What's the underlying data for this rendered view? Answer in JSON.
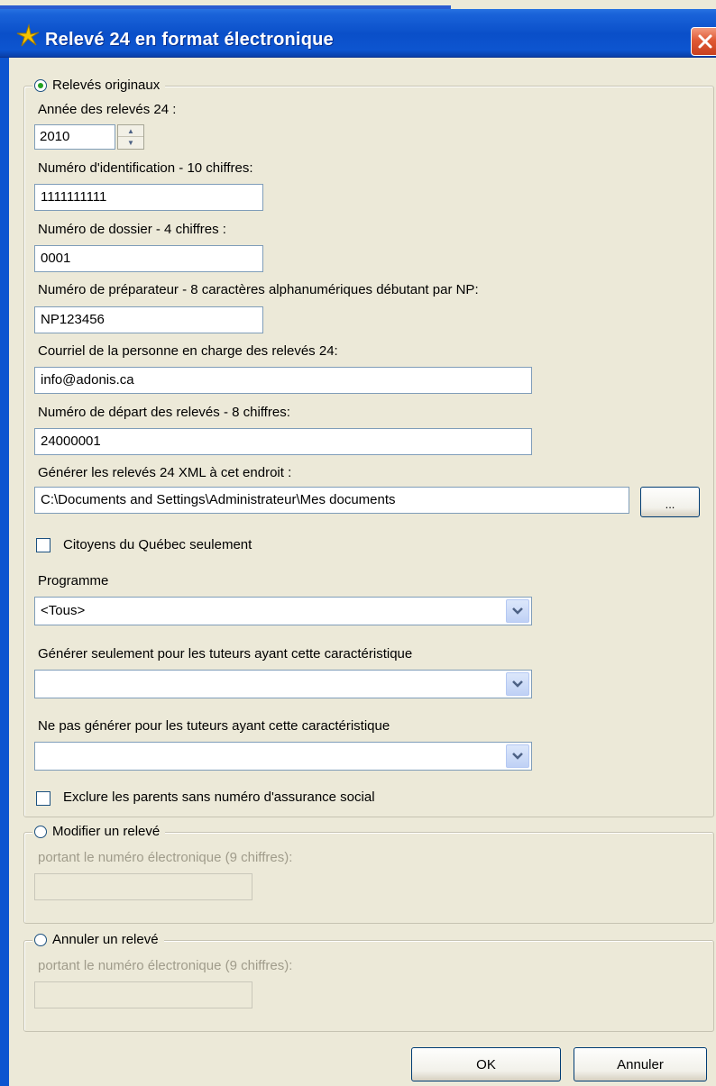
{
  "window": {
    "title": "Relevé 24 en format électronique"
  },
  "originals": {
    "radio_label": "Relevés originaux",
    "year_label": "Année des relevés 24 :",
    "year_value": "2010",
    "id_label": "Numéro d'identification - 10 chiffres:",
    "id_value": "1111111111",
    "file_label": "Numéro de dossier - 4 chiffres :",
    "file_value": "0001",
    "preparer_label": "Numéro de préparateur - 8 caractères alphanumériques débutant par NP:",
    "preparer_value": "NP123456",
    "email_label": "Courriel de la personne en charge des relevés 24:",
    "email_value": "info@adonis.ca",
    "start_label": "Numéro de départ des relevés - 8 chiffres:",
    "start_value": "24000001",
    "path_label": "Générer les relevés 24 XML à cet endroit :",
    "path_value": "C:\\Documents and Settings\\Administrateur\\Mes documents",
    "browse_label": "...",
    "quebec_only_label": "Citoyens du Québec seulement",
    "program_label": "Programme",
    "program_value": "<Tous>",
    "only_tutors_label": "Générer seulement pour les tuteurs ayant cette caractéristique",
    "only_tutors_value": "",
    "exclude_tutors_label": "Ne pas générer pour les tuteurs ayant cette caractéristique",
    "exclude_tutors_value": "",
    "exclude_parents_label": "Exclure les parents sans numéro d'assurance social"
  },
  "modify": {
    "radio_label": "Modifier un relevé",
    "sub_label": "portant le numéro électronique (9 chiffres):",
    "value": ""
  },
  "cancel_record": {
    "radio_label": "Annuler un relevé",
    "sub_label": "portant le numéro électronique (9 chiffres):",
    "value": ""
  },
  "buttons": {
    "ok": "OK",
    "cancel": "Annuler"
  },
  "colors": {
    "title_bar": "#0a4fc9",
    "dialog_bg": "#ece9d8",
    "close": "#e05a36"
  }
}
